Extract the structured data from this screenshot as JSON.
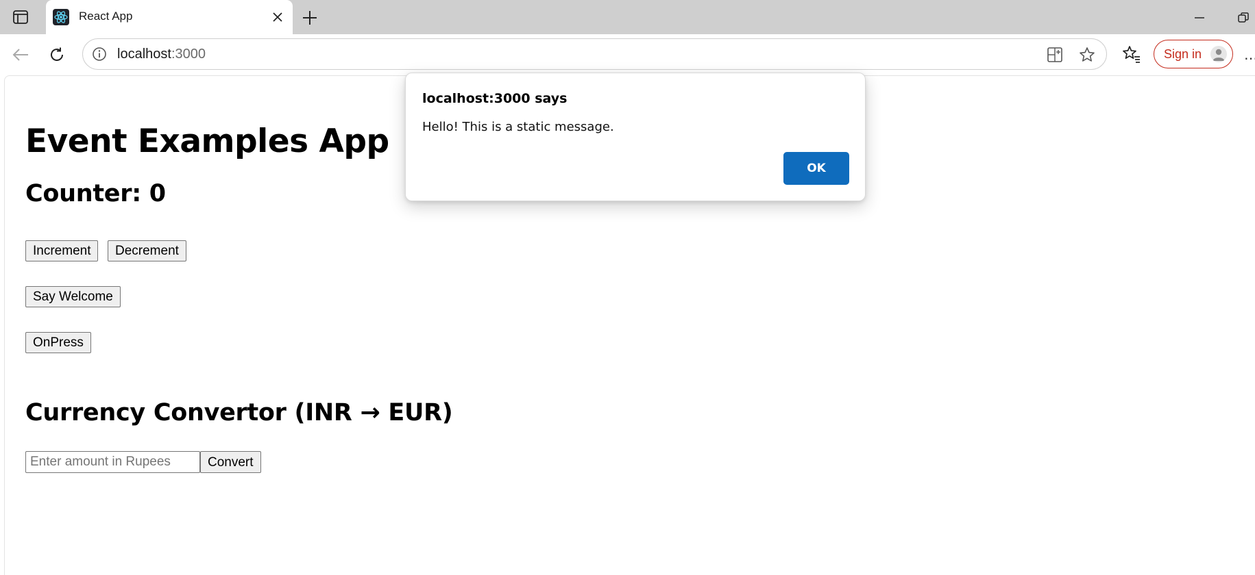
{
  "browser": {
    "tab": {
      "title": "React App",
      "favicon": "react-logo-icon"
    },
    "address_bar": {
      "host": "localhost",
      "port": ":3000"
    },
    "sign_in_label": "Sign in",
    "more_menu": "…"
  },
  "app": {
    "heading": "Event Examples App",
    "counter_heading": "Counter: 0",
    "increment_label": "Increment",
    "decrement_label": "Decrement",
    "say_welcome_label": "Say Welcome",
    "onpress_label": "OnPress",
    "currency_heading": "Currency Convertor (INR → EUR)",
    "amount_placeholder": "Enter amount in Rupees",
    "convert_label": "Convert"
  },
  "alert": {
    "title": "localhost:3000 says",
    "message": "Hello! This is a static message.",
    "ok_label": "OK"
  },
  "colors": {
    "tabstrip": "#cfcfcf",
    "sign_in_accent": "#c42b1c",
    "ok_button": "#0f6cbd"
  }
}
